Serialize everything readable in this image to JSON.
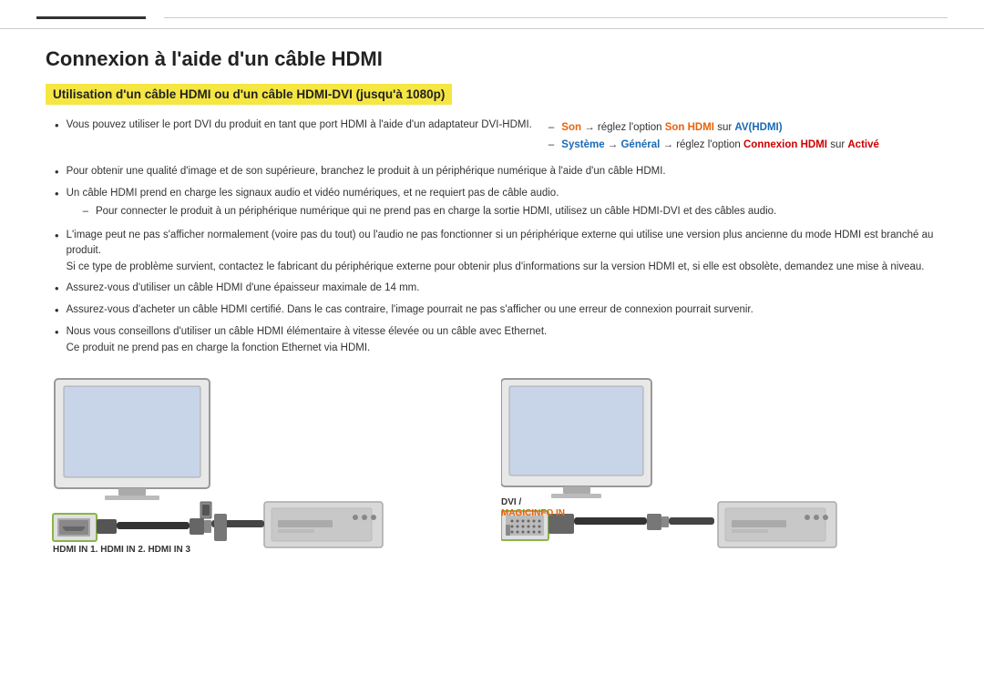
{
  "topbar": {
    "label": ""
  },
  "page": {
    "main_title": "Connexion à l'aide d'un câble HDMI",
    "subtitle": "Utilisation d'un câble HDMI ou d'un câble HDMI-DVI (jusqu'à 1080p)",
    "bullets": [
      {
        "text": "Vous pouvez utiliser le port DVI du produit en tant que port HDMI à l'aide d'un adaptateur DVI-HDMI.",
        "sub_bullets": [
          {
            "text_before": "",
            "text_orange": "Son",
            "text_mid": " → réglez l'option ",
            "text_orange2": "Son HDMI",
            "text_end": " sur ",
            "text_blue": "AV(HDMI)"
          },
          {
            "text_before": "",
            "text_blue1": "Système",
            "text_mid": " → ",
            "text_blue2": "Général",
            "text_end": " → réglez l'option ",
            "text_red": "Connexion HDMI",
            "text_end2": " sur ",
            "text_red2": "Activé"
          }
        ]
      },
      {
        "text": "Pour obtenir une qualité d'image et de son supérieure, branchez le produit à un périphérique numérique à l'aide d'un câble HDMI.",
        "sub_bullets": []
      },
      {
        "text": "Un câble HDMI prend en charge les signaux audio et vidéo numériques, et ne requiert pas de câble audio.",
        "sub_bullets": [
          {
            "plain": "Pour connecter le produit à un périphérique numérique qui ne prend pas en charge la sortie HDMI, utilisez un câble HDMI-DVI et des câbles audio."
          }
        ]
      },
      {
        "text": "L'image peut ne pas s'afficher normalement (voire pas du tout) ou l'audio ne pas fonctionner si un périphérique externe qui utilise une version plus ancienne du mode HDMI est branché au produit. Si ce type de problème survient, contactez le fabricant du périphérique externe pour obtenir plus d'informations sur la version HDMI et, si elle est obsolète, demandez une mise à niveau.",
        "sub_bullets": []
      },
      {
        "text": "Assurez-vous d'utiliser un câble HDMI d'une épaisseur maximale de 14 mm.",
        "sub_bullets": []
      },
      {
        "text": "Assurez-vous d'acheter un câble HDMI certifié. Dans le cas contraire, l'image pourrait ne pas s'afficher ou une erreur de connexion pourrait survenir.",
        "sub_bullets": []
      },
      {
        "text": "Nous vous conseillons d'utiliser un câble HDMI élémentaire à vitesse élevée ou un câble avec Ethernet. Ce produit ne prend pas en charge la fonction Ethernet via HDMI.",
        "sub_bullets": []
      }
    ],
    "left_diagram": {
      "port_label": "HDMI IN 1, HDMI IN 2, HDMI IN 3"
    },
    "right_diagram": {
      "port_label1": "DVI /",
      "port_label2": "MAGICINFO IN"
    }
  }
}
